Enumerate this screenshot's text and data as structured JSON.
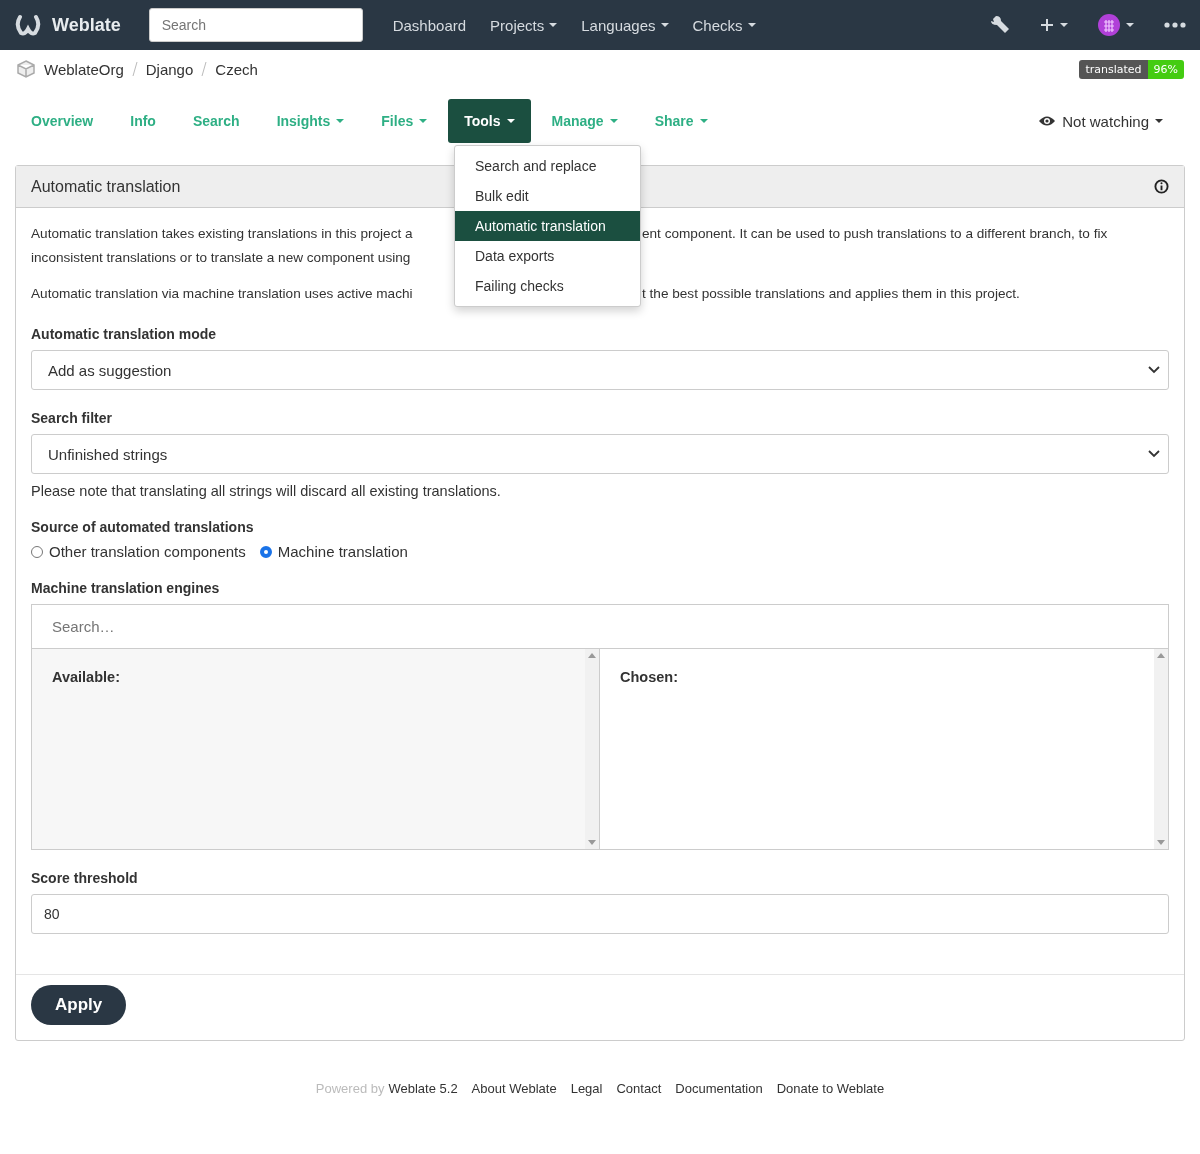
{
  "navbar": {
    "brand": "Weblate",
    "search": {
      "placeholder": "Search"
    },
    "items": [
      {
        "label": "Dashboard",
        "has_menu": false
      },
      {
        "label": "Projects",
        "has_menu": true
      },
      {
        "label": "Languages",
        "has_menu": true
      },
      {
        "label": "Checks",
        "has_menu": true
      }
    ]
  },
  "breadcrumbs": [
    "WeblateOrg",
    "Django",
    "Czech"
  ],
  "badge": {
    "label": "translated",
    "value": "96%"
  },
  "tabs": [
    {
      "label": "Overview",
      "has_menu": false,
      "selected": false
    },
    {
      "label": "Info",
      "has_menu": false,
      "selected": false
    },
    {
      "label": "Search",
      "has_menu": false,
      "selected": false
    },
    {
      "label": "Insights",
      "has_menu": true,
      "selected": false
    },
    {
      "label": "Files",
      "has_menu": true,
      "selected": false
    },
    {
      "label": "Tools",
      "has_menu": true,
      "selected": true
    },
    {
      "label": "Manage",
      "has_menu": true,
      "selected": false
    },
    {
      "label": "Share",
      "has_menu": true,
      "selected": false
    }
  ],
  "watch": {
    "label": "Not watching"
  },
  "tools_menu": [
    {
      "label": "Search and replace",
      "selected": false
    },
    {
      "label": "Bulk edit",
      "selected": false
    },
    {
      "label": "Automatic translation",
      "selected": true
    },
    {
      "label": "Data exports",
      "selected": false
    },
    {
      "label": "Failing checks",
      "selected": false
    }
  ],
  "panel": {
    "title": "Automatic translation",
    "description": [
      {
        "lines": [
          {
            "left": "Automatic translation takes existing translations in this project a",
            "right": "ent component. It can be used to push translations to a different branch, to fix"
          },
          {
            "left": "inconsistent translations or to translate a new component using"
          }
        ]
      },
      {
        "lines": [
          {
            "left": "Automatic translation via machine translation uses active machi",
            "right": "t the best possible translations and applies them in this project."
          }
        ]
      }
    ],
    "mode": {
      "label": "Automatic translation mode",
      "value": "Add as suggestion"
    },
    "filter": {
      "label": "Search filter",
      "value": "Unfinished strings",
      "help": "Please note that translating all strings will discard all existing translations."
    },
    "source": {
      "label": "Source of automated translations",
      "options": [
        {
          "label": "Other translation components",
          "selected": false
        },
        {
          "label": "Machine translation",
          "selected": true
        }
      ]
    },
    "engines": {
      "label": "Machine translation engines",
      "search": {
        "placeholder": "Search…"
      },
      "available": "Available:",
      "chosen": "Chosen:"
    },
    "threshold": {
      "label": "Score threshold",
      "value": "80"
    },
    "apply": "Apply"
  },
  "footer": {
    "powered": "Powered by",
    "version": "Weblate 5.2",
    "links": [
      "About Weblate",
      "Legal",
      "Contact",
      "Documentation",
      "Donate to Weblate"
    ]
  }
}
